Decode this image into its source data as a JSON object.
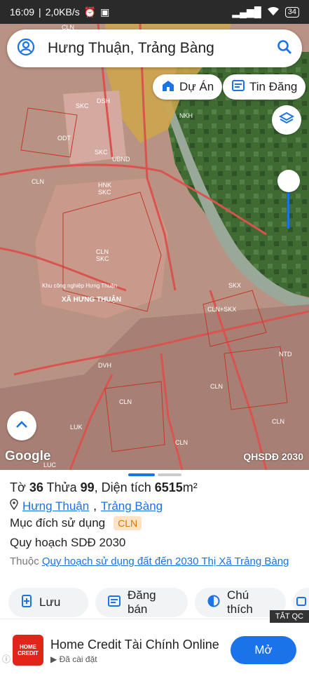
{
  "status_bar": {
    "time": "16:09",
    "speed": "2,0KB/s",
    "battery": "34"
  },
  "search": {
    "query": "Hưng Thuận, Trảng Bàng"
  },
  "chips": {
    "du_an": "Dự Án",
    "tin_dang": "Tin Đăng"
  },
  "map": {
    "google_label": "Google",
    "overlay_label": "QHSDĐ 2030",
    "labels": [
      "CLN",
      "SKC",
      "DSH",
      "ODT",
      "SKC",
      "UBND",
      "CLN",
      "HNK",
      "SKC",
      "Khu công nghiệp Hưng Thuận",
      "CLN",
      "SKC",
      "XÃ HƯNG THUẬN",
      "NKH",
      "SKX",
      "CLN+SKX",
      "DVH",
      "CLN",
      "CLN",
      "LUK",
      "LUC",
      "NTD",
      "CLN",
      "CLN"
    ]
  },
  "parcel": {
    "to_label": "Tờ",
    "to": "36",
    "thua_label": "Thửa",
    "thua": "99",
    "area_label": ", Diện tích",
    "area": "6515",
    "area_unit": "m²",
    "location_1": "Hưng Thuận",
    "location_sep": ",",
    "location_2": "Trảng Bàng",
    "purpose_label": "Mục đích sử dụng",
    "purpose_code": "CLN",
    "plan_label": "Quy hoạch SDĐ 2030",
    "belongs_label": "Thuộc",
    "belongs_link": "Quy hoạch sử dụng đất đến 2030 Thị Xã Trảng Bàng"
  },
  "actions": {
    "save": "Lưu",
    "post_sale": "Đăng bán",
    "legend": "Chú thích"
  },
  "ad": {
    "close_label": "TẮT QC",
    "logo_text": "HOME CREDIT",
    "title": "Home Credit Tài Chính Online",
    "subtitle": "Đã cài đặt",
    "button": "Mở"
  },
  "colors": {
    "accent": "#1a73e8",
    "badge_bg": "#fde3c4",
    "badge_text": "#d97706",
    "ad_red": "#e1251b"
  }
}
